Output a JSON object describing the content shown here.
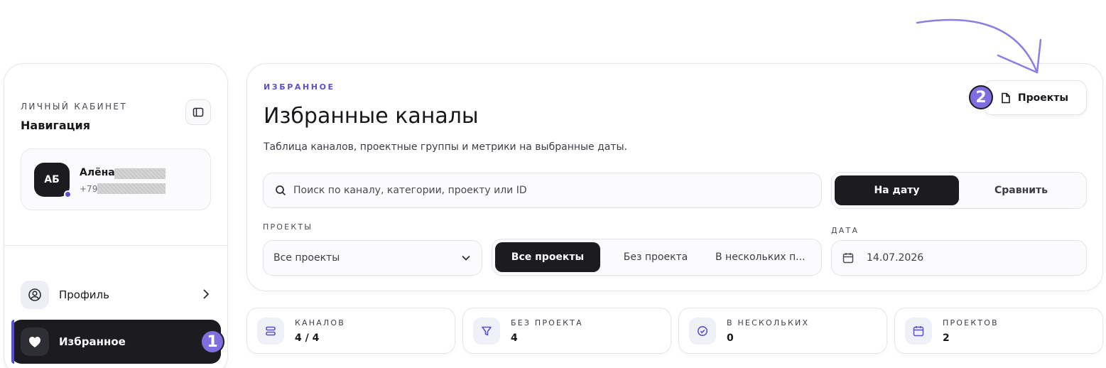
{
  "sidebar": {
    "kicker": "ЛИЧНЫЙ КАБИНЕТ",
    "title": "Навигация",
    "user": {
      "initials": "АБ",
      "name": "Алёна",
      "phone": "+79"
    },
    "nav": [
      {
        "label": "Профиль",
        "icon": "user-circle-icon"
      },
      {
        "label": "Избранное",
        "icon": "heart-icon",
        "active": true
      }
    ]
  },
  "badges": {
    "step1": "1",
    "step2": "2"
  },
  "main": {
    "kicker": "ИЗБРАННОЕ",
    "title": "Избранные каналы",
    "description": "Таблица каналов, проектные группы и метрики на выбранные даты.",
    "projects_button": "Проекты",
    "search_placeholder": "Поиск по каналу, категории, проекту или ID",
    "mode": {
      "on_date": "На дату",
      "compare": "Сравнить"
    },
    "projects_label": "ПРОЕКТЫ",
    "projects_select": "Все проекты",
    "filter": {
      "all": "Все проекты",
      "none": "Без проекта",
      "multiple": "В нескольких п..."
    },
    "date_label": "ДАТА",
    "date_value": "14.07.2026"
  },
  "stats": [
    {
      "label": "КАНАЛОВ",
      "value": "4 / 4",
      "icon": "layers-icon"
    },
    {
      "label": "БЕЗ ПРОЕКТА",
      "value": "4",
      "icon": "filter-icon"
    },
    {
      "label": "В НЕСКОЛЬКИХ",
      "value": "0",
      "icon": "check-circle-icon"
    },
    {
      "label": "ПРОЕКТОВ",
      "value": "2",
      "icon": "calendar-icon"
    }
  ],
  "colors": {
    "accent": "#5a4fd0",
    "badge": "#7e6ee0",
    "dark": "#1b1b20",
    "arrow": "#8a7ee0"
  }
}
